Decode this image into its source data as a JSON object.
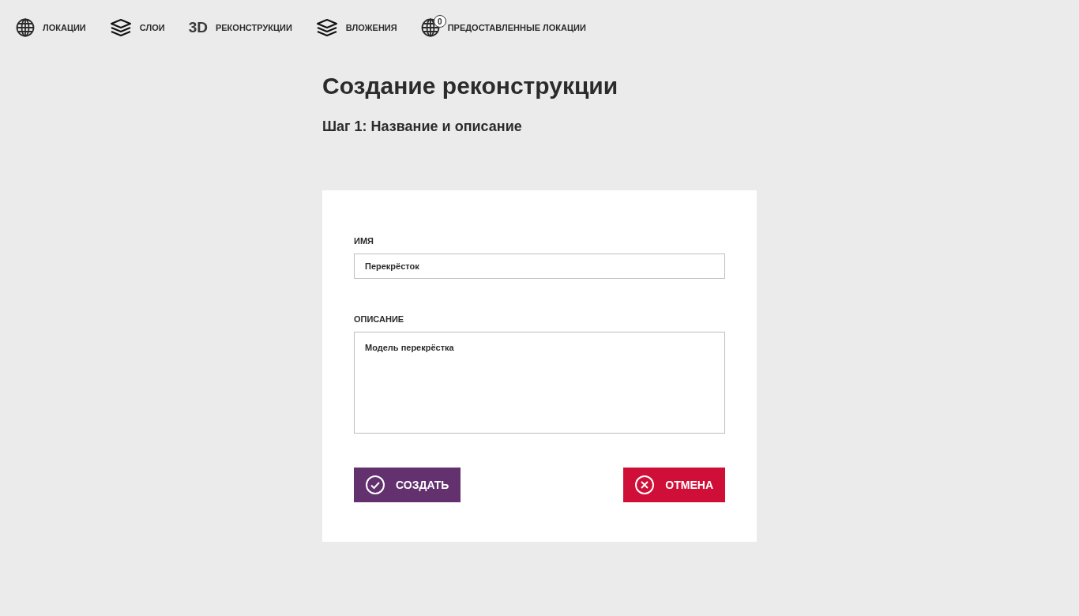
{
  "nav": [
    {
      "kind": "globe",
      "label": "ЛОКАЦИИ"
    },
    {
      "kind": "layers",
      "label": "СЛОИ"
    },
    {
      "kind": "text",
      "icon_text": "3D",
      "label": "РЕКОНСТРУКЦИИ"
    },
    {
      "kind": "layers",
      "label": "ВЛОЖЕНИЯ"
    },
    {
      "kind": "globe",
      "badge": "0",
      "label": "ПРЕДОСТАВЛЕННЫЕ ЛОКАЦИИ"
    }
  ],
  "title": "Создание реконструкции",
  "subtitle": "Шаг 1: Название и описание",
  "form": {
    "fields": [
      {
        "kind": "input",
        "label": "ИМЯ",
        "value": "Перекрёсток"
      },
      {
        "kind": "textarea",
        "label": "ОПИСАНИЕ",
        "value": "Модель перекрёстка"
      }
    ],
    "buttons": [
      {
        "kind": "confirm",
        "label": "СОЗДАТЬ"
      },
      {
        "kind": "cancel",
        "label": "ОТМЕНА"
      }
    ]
  }
}
